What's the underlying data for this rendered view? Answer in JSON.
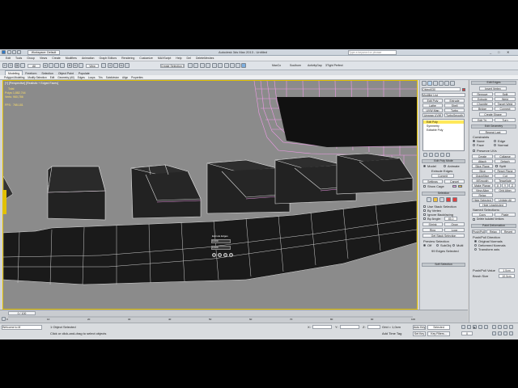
{
  "window": {
    "title": "Autodesk 3ds Max 2013 - Untitled",
    "workspace": "Workspace: Default",
    "search_placeholder": "Type a keyword or phrase"
  },
  "menus": [
    "Edit",
    "Tools",
    "Group",
    "Views",
    "Create",
    "Modifiers",
    "Animation",
    "Graph Editors",
    "Rendering",
    "Customize",
    "MAXScript",
    "Help",
    "DeI",
    "DeleteMeshes"
  ],
  "toolbar": {
    "selection_filter": "All",
    "view_dropdown": "View",
    "selection_set": "Create Selection Se",
    "extra": [
      "MaxCo",
      "Soulburn",
      "ActivityGap",
      "3Tight Perfect"
    ]
  },
  "ribbon": {
    "tabs": [
      "Modeling",
      "Freeform",
      "Selection",
      "Object Paint",
      "Populate"
    ],
    "active_tab": "Modeling",
    "items": [
      "Polygon Modeling",
      "Modify Selection",
      "Edit",
      "Geometry (All)",
      "Edges",
      "Loops",
      "Tris",
      "Subdivision",
      "Align",
      "Properties"
    ]
  },
  "viewport": {
    "label": "[+] [Perspective] [Realistic + Edged Faces]",
    "stats": {
      "header": "Total",
      "polys_label": "Polys:",
      "polys_value": "1,882,744",
      "verts_label": "Verts:",
      "verts_value": "960,786",
      "fps_label": "FPS:",
      "fps_value": "765.181"
    },
    "caddy": {
      "title": "Extrude Edges",
      "value1": "0.000",
      "value2": "0.000"
    }
  },
  "command_panel": {
    "object_name": "Object030",
    "modifier_list": "Modifier List",
    "stack": [
      "Edit Poly",
      "Symmetry",
      "Editable Poly"
    ],
    "mod_buttons_left": [
      "Edit Poly",
      "Lathe",
      "UVW Map",
      "Unwrap UVW"
    ],
    "mod_buttons_right": [
      "Extrude",
      "Shell",
      "Turbo",
      "TurboSmooth"
    ],
    "edit_poly_mode": {
      "header": "Edit Poly Mode",
      "option_model": "Model",
      "option_animate": "Animate",
      "extrude_edges": "Extrude Edges",
      "commit": "Commit",
      "settings": "Settings",
      "cancel": "Cancel",
      "show_cage": "Show Cage"
    },
    "selection": {
      "header": "Selection",
      "use_stack_selection": "Use Stack Selection",
      "by_vertex": "By Vertex",
      "ignore_backfacing": "Ignore Backfacing",
      "by_angle": "By Angle:",
      "by_angle_value": "45.0",
      "shrink": "Shrink",
      "grow": "Grow",
      "ring": "Ring",
      "loop": "Loop",
      "get_stack_selection": "Get Stack Selection",
      "preview_selection": "Preview Selection",
      "off": "Off",
      "subobj": "SubObj",
      "multi": "Multi",
      "status": "99 Edges Selected"
    },
    "soft_selection": "Soft Selection"
  },
  "command_panel2": {
    "edit_edges_header": "Edit Edges",
    "insert_vertex": "Insert Vertex",
    "buttons": [
      [
        "Remove",
        "Split"
      ],
      [
        "Extrude",
        "Weld"
      ],
      [
        "Chamfer",
        "Target Weld"
      ],
      [
        "Bridge",
        "Connect"
      ]
    ],
    "create_shape": "Create Shape",
    "edit_tri": "Edit Tri.",
    "turn": "Turn",
    "edit_geometry_header": "Edit Geometry",
    "repeat_last": "Repeat Last",
    "constraints": "Constraints",
    "none": "None",
    "edge": "Edge",
    "face": "Face",
    "normal": "Normal",
    "preserve_uvs": "Preserve UVs",
    "create": "Create",
    "collapse": "Collapse",
    "attach": "Attach",
    "detach": "Detach",
    "slice_plane": "Slice Plane",
    "split": "Split",
    "slice": "Slice",
    "reset_plane": "Reset Plane",
    "quickslice": "QuickSlice",
    "cut": "Cut",
    "msmooth": "MSmooth",
    "tessellate": "Tessellate",
    "make_planar": "Make Planar",
    "view_align": "View Align",
    "grid_align": "Grid Align",
    "relax": "Relax",
    "hide_selected": "Hide Selected",
    "unhide_all": "Unhide All",
    "hide_unselected": "Hide Unselected",
    "named_selections": "Named Selections:",
    "copy": "Copy",
    "paste": "Paste",
    "delete_isolated": "Delete Isolated Vertices",
    "paint_deformation": "Paint Deformation",
    "push_pull": "Push/Pull",
    "relax2": "Relax",
    "revert": "Revert",
    "push_pull_direction": "Push/Pull Direction",
    "original_normals": "Original Normals",
    "deformed_normals": "Deformed Normals",
    "transform_axis": "Transform axis",
    "pushpull_value_label": "Push/Pull Value",
    "pushpull_value": "1.0cm",
    "brush_size_label": "Brush Size",
    "brush_size": "10.0cm"
  },
  "timeline": {
    "frame_counter": "0 / 100",
    "ticks": [
      "0",
      "10",
      "20",
      "30",
      "40",
      "50",
      "60",
      "70",
      "80",
      "90",
      "100"
    ]
  },
  "status": {
    "maxscript": "Welcome to M",
    "line1": "1 Object Selected",
    "line2": "Click or click-and-drag to select objects",
    "x_label": "X:",
    "y_label": "Y:",
    "z_label": "Z:",
    "grid": "Grid = 1,0cm",
    "add_time_tag": "Add Time Tag",
    "auto_key": "Auto Key",
    "selected": "Selected",
    "set_key": "Set Key",
    "key_filters": "Key Filters...",
    "frame": "0"
  },
  "colors": {
    "viewport_bg": "#8b8b8b",
    "active_border": "#e2c100",
    "cage_pink": "#f09be8",
    "stack_highlight": "#ffe85a",
    "accent_red": "#e04040"
  }
}
